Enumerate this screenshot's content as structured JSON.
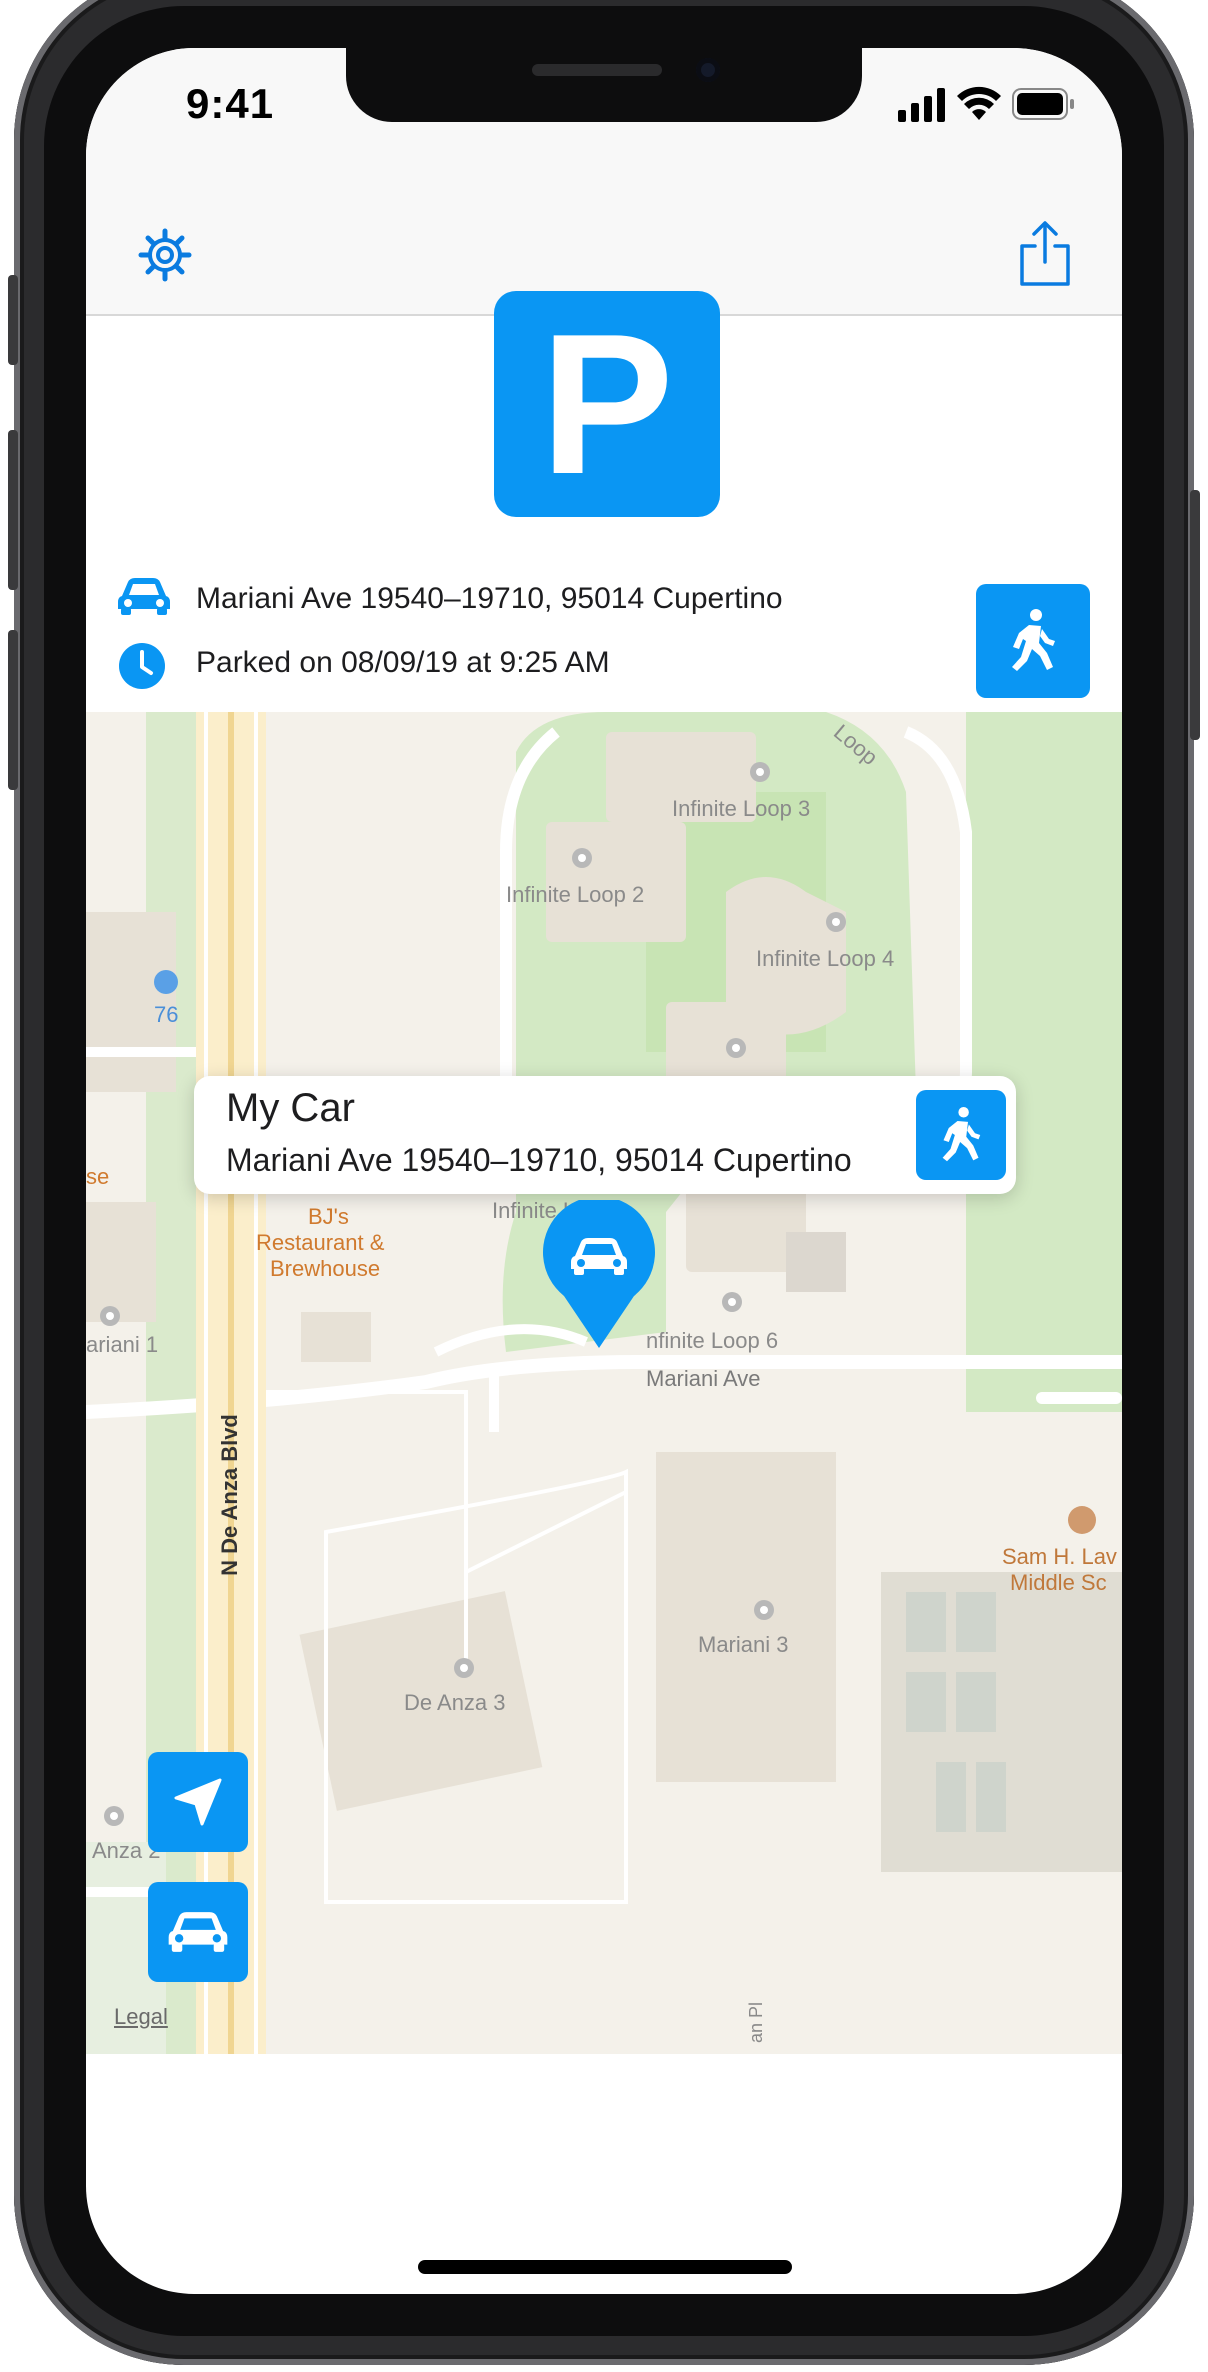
{
  "status_bar": {
    "time": "9:41"
  },
  "parking": {
    "sign_letter": "P",
    "address": "Mariani Ave 19540–19710, 95014 Cupertino",
    "parked_time": "Parked on 08/09/19 at 9:25 AM"
  },
  "callout": {
    "title": "My Car",
    "address": "Mariani Ave 19540–19710, 95014 Cupertino"
  },
  "map_labels": {
    "loop": "Loop",
    "infinite_loop_3": "Infinite Loop 3",
    "infinite_loop_2": "Infinite Loop 2",
    "infinite_loop_4": "Infinite Loop 4",
    "gas_76": "76",
    "infinite_loop_1": "Infinite Loop",
    "se": "se",
    "bjs_1": "BJ's",
    "bjs_2": "Restaurant &",
    "bjs_3": "Brewhouse",
    "ariani_1": "ariani 1",
    "infinite_loop_6": "nfinite Loop 6",
    "mariani_ave": "Mariani Ave",
    "n_de_anza": "N De Anza Blvd",
    "sam_1": "Sam H. Lav",
    "sam_2": "Middle Sc",
    "mariani_3": "Mariani 3",
    "de_anza_3": "De Anza 3",
    "anza_2": "Anza 2",
    "an_pl": "an Pl",
    "legal": "Legal"
  },
  "colors": {
    "accent": "#0a96f3",
    "map_background": "#f4f1ea",
    "park_green": "#cfe8c1",
    "poi_orange": "#d07a2e"
  },
  "icons": {
    "settings": "gear-icon",
    "share": "share-icon",
    "car": "car-icon",
    "clock": "clock-icon",
    "walk": "walking-person-icon",
    "location": "location-arrow-icon",
    "car_pin": "car-pin-icon"
  }
}
